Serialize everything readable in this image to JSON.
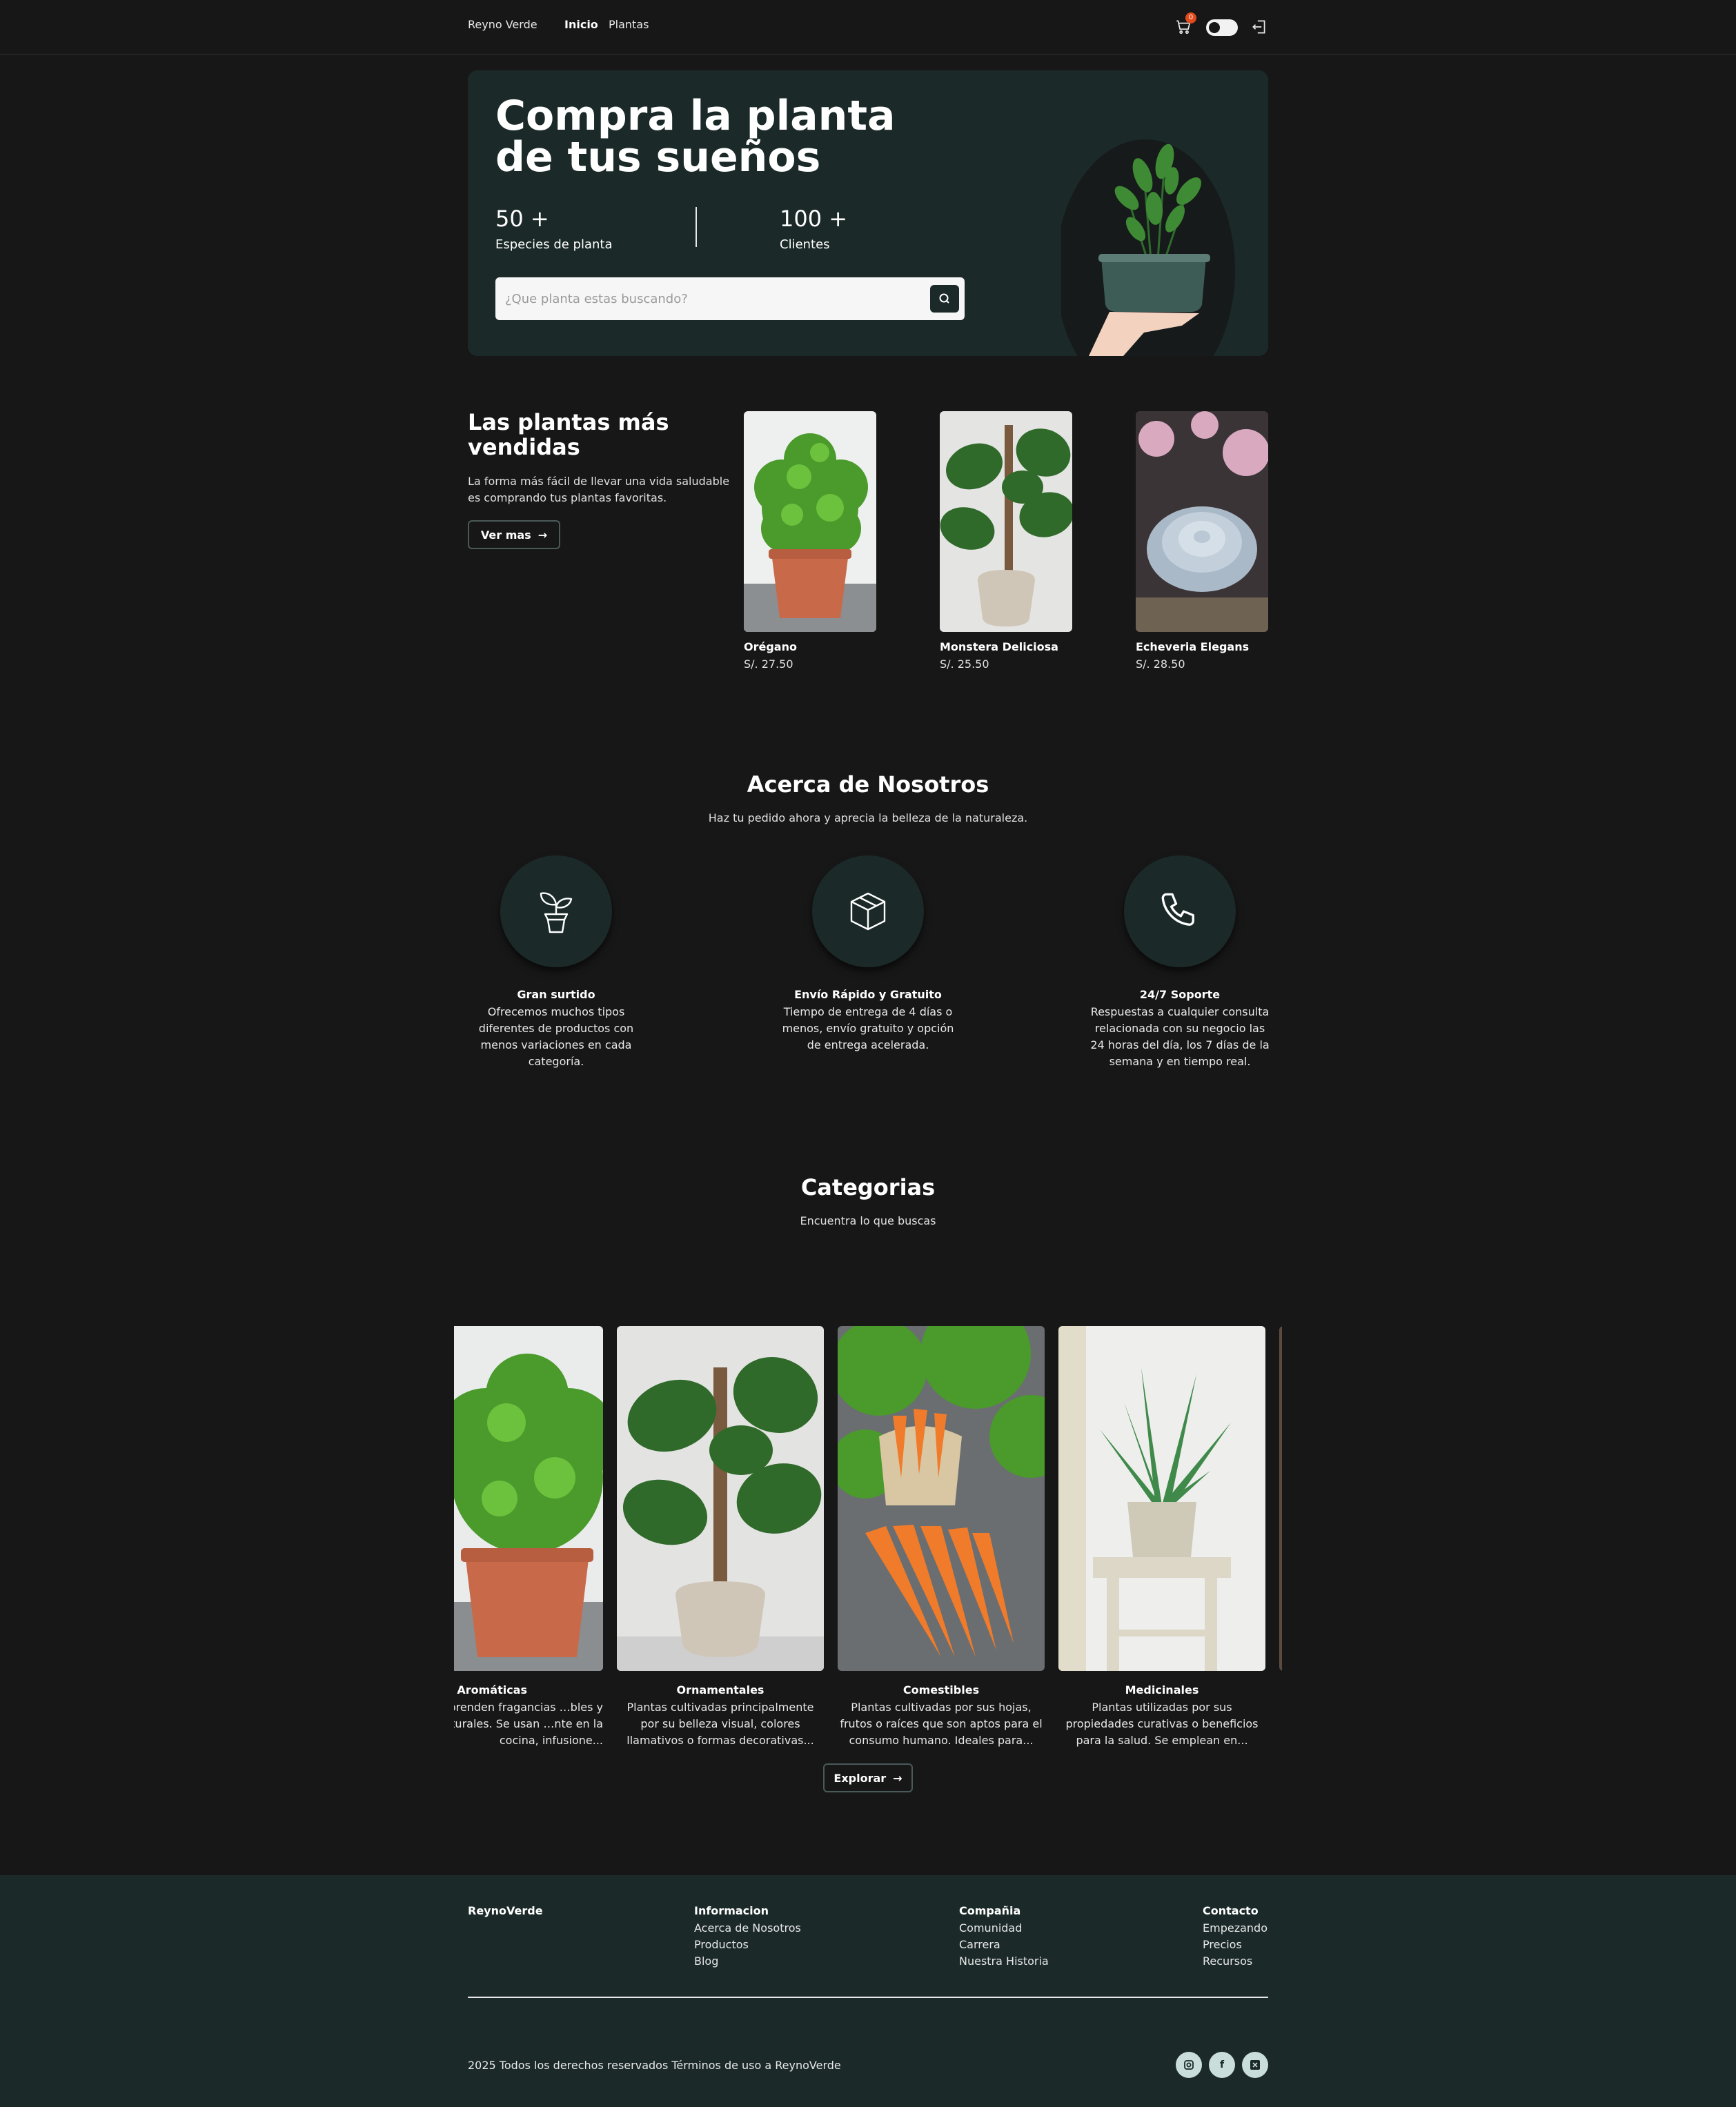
{
  "navbar": {
    "brand": "Reyno Verde",
    "links": [
      {
        "label": "Inicio",
        "active": true
      },
      {
        "label": "Plantas",
        "active": false
      }
    ],
    "cart_count": "0",
    "icons": [
      "cart-icon",
      "theme-toggle",
      "logout-icon"
    ]
  },
  "hero": {
    "title": "Compra la planta de tus sueños",
    "stats": [
      {
        "value": "50 +",
        "label": "Especies de planta"
      },
      {
        "value": "100 +",
        "label": "Clientes"
      }
    ],
    "search": {
      "placeholder": "¿Que planta estas buscando?",
      "value": ""
    },
    "background_color": "#1b2a29"
  },
  "best_sellers": {
    "title": "Las plantas más vendidas",
    "description": "La forma más fácil de llevar una vida saludable es comprando tus plantas favoritas.",
    "button_label": "Ver mas",
    "products": [
      {
        "name": "Orégano",
        "price": "S/. 27.50"
      },
      {
        "name": "Monstera Deliciosa",
        "price": "S/. 25.50"
      },
      {
        "name": "Echeveria Elegans",
        "price": "S/. 28.50"
      }
    ]
  },
  "about": {
    "title": "Acerca de Nosotros",
    "subtitle": "Haz tu pedido ahora y aprecia la belleza de la naturaleza.",
    "features": [
      {
        "icon": "plant-pot-icon",
        "title": "Gran surtido",
        "description": "Ofrecemos muchos tipos diferentes de productos con menos variaciones en cada categoría."
      },
      {
        "icon": "box-icon",
        "title": "Envío Rápido y Gratuito",
        "description": "Tiempo de entrega de 4 días o menos, envío gratuito y opción de entrega acelerada."
      },
      {
        "icon": "phone-icon",
        "title": "24/7 Soporte",
        "description": "Respuestas a cualquier consulta relacionada con su negocio las 24 horas del día, los 7 días de la semana y en tiempo real."
      }
    ]
  },
  "categories": {
    "title": "Categorias",
    "subtitle": "Encuentra lo que buscas",
    "button_label": "Explorar",
    "items": [
      {
        "title": "Aromáticas",
        "description": "…ue desprenden fragancias …bles y naturales. Se usan …nte en la cocina, infusione..."
      },
      {
        "title": "Ornamentales",
        "description": "Plantas cultivadas principalmente por su belleza visual, colores llamativos o formas decorativas..."
      },
      {
        "title": "Comestibles",
        "description": "Plantas cultivadas por sus hojas, frutos o raíces que son aptos para el consumo humano. Ideales para..."
      },
      {
        "title": "Medicinales",
        "description": "Plantas utilizadas por sus propiedades curativas o beneficios para la salud. Se emplean en..."
      }
    ]
  },
  "footer": {
    "brand": "ReynoVerde",
    "columns": [
      {
        "heading": "Informacion",
        "links": [
          "Acerca de Nosotros",
          "Productos",
          "Blog"
        ]
      },
      {
        "heading": "Compañia",
        "links": [
          "Comunidad",
          "Carrera",
          "Nuestra Historia"
        ]
      },
      {
        "heading": "Contacto",
        "links": [
          "Empezando",
          "Precios",
          "Recursos"
        ]
      }
    ],
    "copyright": "2025 Todos los derechos reservados Términos de uso a ReynoVerde",
    "social": [
      "instagram-icon",
      "facebook-icon",
      "x-icon"
    ]
  },
  "colors": {
    "background": "#171717",
    "panel": "#1b2a29",
    "accent_badge": "#e04a1c"
  }
}
